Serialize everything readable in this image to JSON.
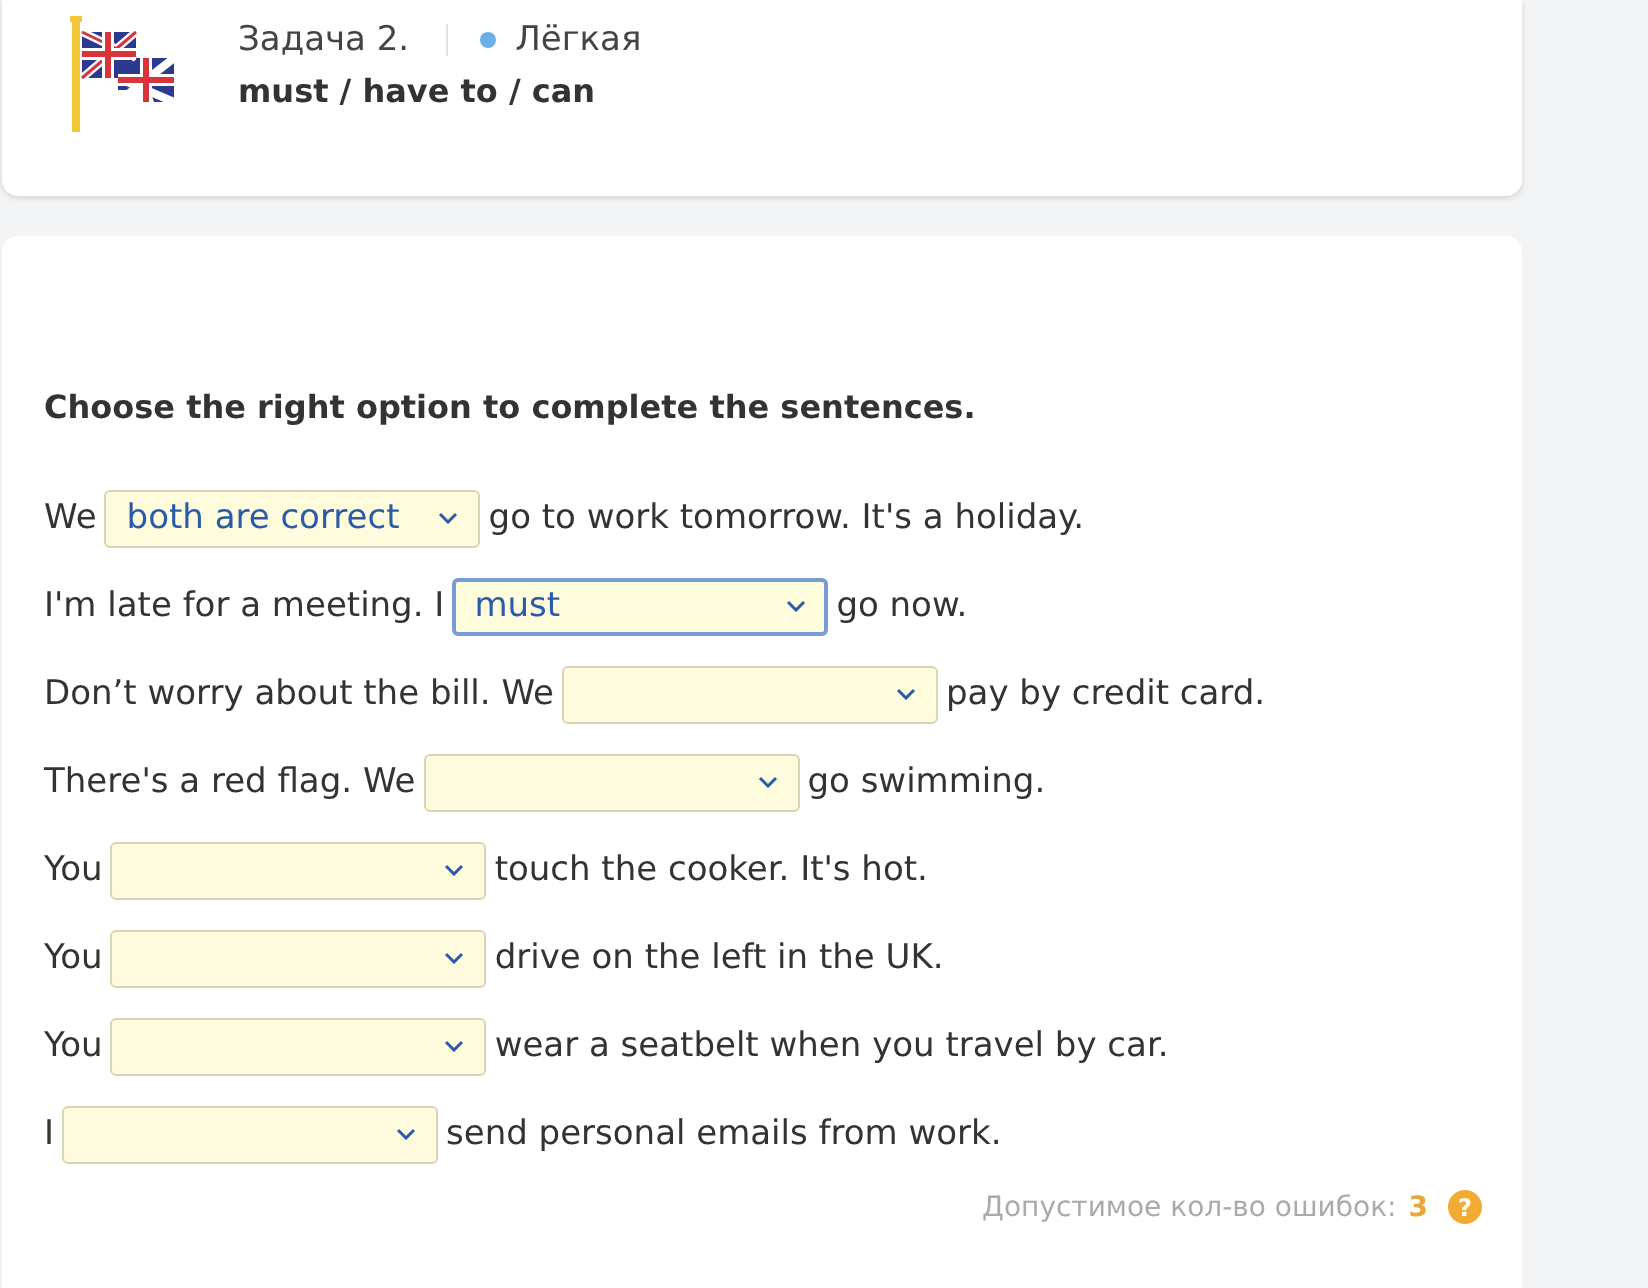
{
  "task": {
    "number": "Задача 2.",
    "difficulty": "Лёгкая",
    "title": "must / have to / can"
  },
  "exercise": {
    "instruction": "Choose the right option to complete the sentences.",
    "sentences": [
      {
        "before": "We",
        "value": "both are correct",
        "focused": false,
        "after": "go to work tomorrow. It's a holiday."
      },
      {
        "before": "I'm late for a meeting. I",
        "value": "must",
        "focused": true,
        "after": "go now."
      },
      {
        "before": "Don’t worry about the bill. We",
        "focused": false,
        "after": "pay by credit card."
      },
      {
        "before": "There's a red flag. We",
        "focused": false,
        "after": "go swimming."
      },
      {
        "before": "You",
        "focused": false,
        "after": "touch the cooker. It's hot."
      },
      {
        "before": "You",
        "focused": false,
        "after": "drive on the left in the UK."
      },
      {
        "before": "You",
        "focused": false,
        "after": "wear a seatbelt when you travel by car."
      },
      {
        "before": "I",
        "focused": false,
        "after": "send personal emails from work."
      }
    ],
    "errors_label": "Допустимое кол-во ошибок:",
    "errors_count": "3",
    "help": "?"
  }
}
